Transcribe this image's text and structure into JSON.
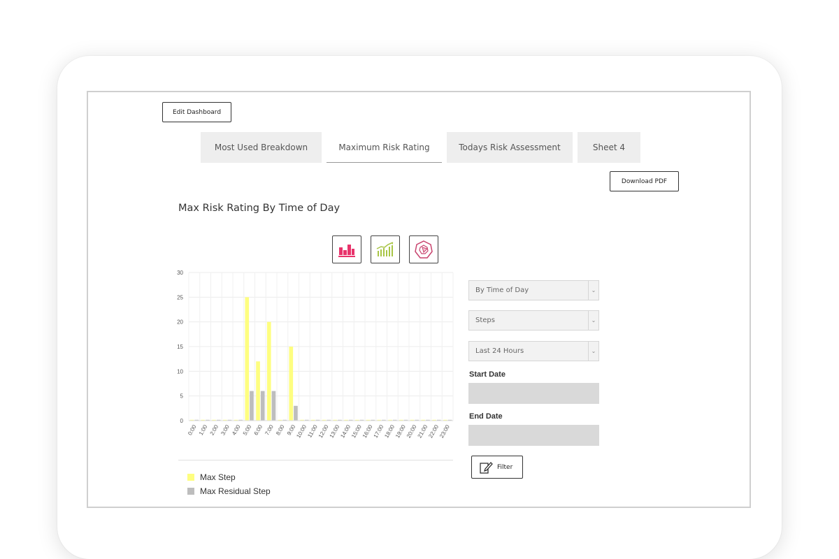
{
  "toolbar": {
    "edit_label": "Edit Dashboard",
    "download_label": "Download PDF"
  },
  "tabs": [
    {
      "label": "Most Used Breakdown",
      "active": false
    },
    {
      "label": "Maximum Risk Rating",
      "active": true
    },
    {
      "label": "Todays Risk Assessment",
      "active": false
    },
    {
      "label": "Sheet 4",
      "active": false
    }
  ],
  "chart_type_icons": [
    "bar-chart-icon",
    "line-chart-icon",
    "radar-chart-icon"
  ],
  "filters": {
    "group_by": "By Time of Day",
    "metric": "Steps",
    "range": "Last 24 Hours",
    "start_label": "Start Date",
    "start_value": "",
    "end_label": "End Date",
    "end_value": "",
    "filter_label": "Filter"
  },
  "colors": {
    "max_step": "#fefe80",
    "max_residual_step": "#bdbdbd",
    "bar_icon": "#e8336b",
    "line_icon": "#a8c545",
    "radar_icon": "#c8436e"
  },
  "chart_data": {
    "type": "bar",
    "title": "Max Risk Rating By Time of Day",
    "categories": [
      "0:00",
      "1:00",
      "2:00",
      "3:00",
      "4:00",
      "5:00",
      "6:00",
      "7:00",
      "8:00",
      "9:00",
      "10:00",
      "11:00",
      "12:00",
      "13:00",
      "14:00",
      "15:00",
      "16:00",
      "17:00",
      "18:00",
      "19:00",
      "20:00",
      "21:00",
      "22:00",
      "23:00"
    ],
    "series": [
      {
        "name": "Max Step",
        "values": [
          0,
          0,
          0,
          0,
          0,
          25,
          12,
          20,
          0,
          15,
          0,
          0,
          0,
          0,
          0,
          0,
          0,
          0,
          0,
          0,
          0,
          0,
          0,
          0
        ]
      },
      {
        "name": "Max Residual Step",
        "values": [
          0,
          0,
          0,
          0,
          0,
          6,
          6,
          6,
          0,
          3,
          0,
          0,
          0,
          0,
          0,
          0,
          0,
          0,
          0,
          0,
          0,
          0,
          0,
          0
        ]
      }
    ],
    "ylim": [
      0,
      30
    ],
    "yticks": [
      0,
      5,
      10,
      15,
      20,
      25,
      30
    ],
    "grid": true,
    "legend": "bottom-left"
  }
}
